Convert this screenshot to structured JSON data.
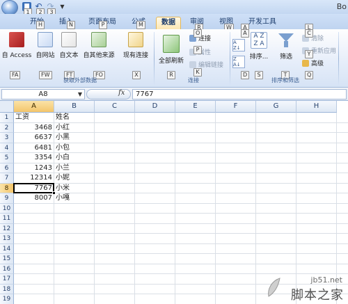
{
  "titlebar": {
    "title": "Bo",
    "key_tips": [
      "1",
      "2",
      "3"
    ]
  },
  "tabs": [
    {
      "label": "开始",
      "key_tip": "H",
      "active": false
    },
    {
      "label": "插入",
      "key_tip": "N",
      "active": false
    },
    {
      "label": "页面布局",
      "key_tip": "P",
      "active": false
    },
    {
      "label": "公式",
      "key_tip": "M",
      "active": false
    },
    {
      "label": "数据",
      "key_tip": "A",
      "active": true
    },
    {
      "label": "审阅",
      "key_tip": "R",
      "active": false
    },
    {
      "label": "视图",
      "key_tip": "W",
      "active": false
    },
    {
      "label": "开发工具",
      "key_tip": "L",
      "active": false
    }
  ],
  "ribbon": {
    "get_external": {
      "group_label": "获取外部数据",
      "buttons": [
        {
          "label": "自 Access",
          "key_tip": "FA",
          "icon": "access-icon"
        },
        {
          "label": "自网站",
          "key_tip": "FW",
          "icon": "web-icon"
        },
        {
          "label": "自文本",
          "key_tip": "FT",
          "icon": "text-file-icon"
        },
        {
          "label": "自其他来源",
          "key_tip": "FO",
          "icon": "other-sources-icon"
        },
        {
          "label": "现有连接",
          "key_tip": "X",
          "icon": "existing-connections-icon"
        }
      ]
    },
    "connections": {
      "group_label": "连接",
      "refresh_label": "全部刷新",
      "refresh_key_tip": "R",
      "connections_label": "连接",
      "connections_key_tip": "O",
      "properties_label": "属性",
      "properties_key_tip": "P",
      "edit_links_label": "编辑链接",
      "edit_links_key_tip": "K"
    },
    "sort_filter": {
      "group_label": "排序和筛选",
      "sort_label": "排序...",
      "sort_key_tip": "S",
      "sort_asc_key_tip": "A",
      "sort_desc_key_tip": "D",
      "filter_label": "筛选",
      "filter_key_tip": "T",
      "clear_label": "清除",
      "clear_key_tip": "C",
      "reapply_label": "重新应用",
      "reapply_key_tip": "Y",
      "advanced_label": "高级",
      "advanced_key_tip": "Q"
    }
  },
  "formula_bar": {
    "name_box": "A8",
    "fx": "fx",
    "value": "7767"
  },
  "sheet": {
    "columns": [
      "A",
      "B",
      "C",
      "D",
      "E",
      "F",
      "G",
      "H"
    ],
    "selected_column": "A",
    "selected_row": 8,
    "row_count": 19,
    "rows": [
      {
        "a": "工资",
        "b": "姓名"
      },
      {
        "a": "3468",
        "b": "小红"
      },
      {
        "a": "6637",
        "b": "小黑"
      },
      {
        "a": "6481",
        "b": "小包"
      },
      {
        "a": "3354",
        "b": "小白"
      },
      {
        "a": "1243",
        "b": "小兰"
      },
      {
        "a": "12314",
        "b": "小妮"
      },
      {
        "a": "7767",
        "b": "小米"
      },
      {
        "a": "8007",
        "b": "小嘎"
      }
    ]
  },
  "watermark": {
    "url": "jb51.net",
    "name": "脚本之家"
  },
  "colors": {
    "accent": "#e3b75a",
    "ribbon_border": "#9cb5d8",
    "header_text": "#27416b"
  }
}
